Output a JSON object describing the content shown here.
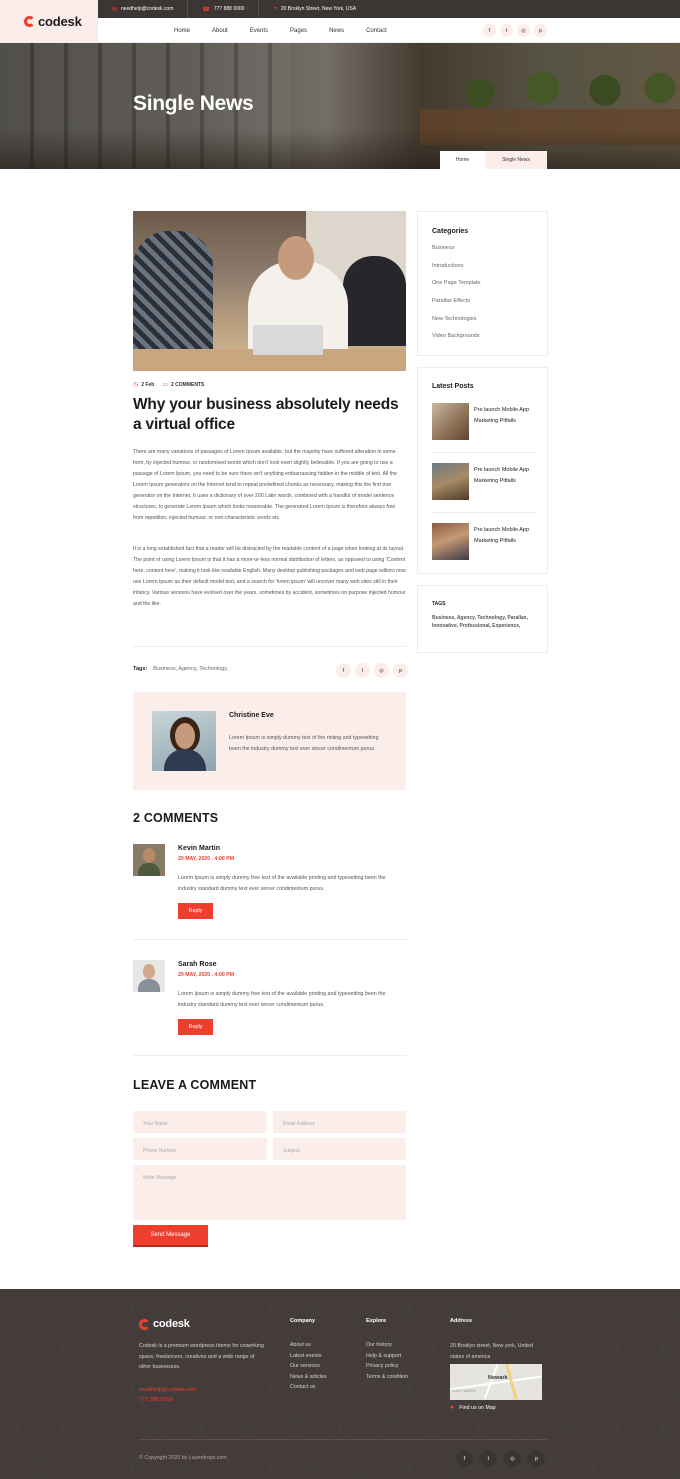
{
  "brand": {
    "name": "codesk"
  },
  "topbar": {
    "email": "needhelp@codesk.com",
    "phone": "777 888 0000",
    "address": "20 Broklyn Street, New York, USA"
  },
  "nav": {
    "items": [
      {
        "label": "Home"
      },
      {
        "label": "About"
      },
      {
        "label": "Events"
      },
      {
        "label": "Pages"
      },
      {
        "label": "News"
      },
      {
        "label": "Contact"
      }
    ],
    "social_icons": [
      "facebook-icon",
      "twitter-icon",
      "instagram-icon",
      "pinterest-icon"
    ]
  },
  "hero": {
    "title": "Single News",
    "breadcrumb": {
      "home": "Home",
      "current": "Single News"
    }
  },
  "post": {
    "date": "2 Feb",
    "comments_count": "2 COMMENTS",
    "title": "Why your business absolutely needs a virtual office",
    "paragraph_1": "There are many variations of passages of Lorem Ipsum available, but the majority have suffered alteration in some form, by injected humour, or randomised words which don't look even slightly believable. If you are going to use a passage of Lorem Ipsum, you need to be sure there isn't anything embarrassing hidden in the middle of text. All the Lorem Ipsum generators on the Internet tend to repeat predefined chunks as necessary, making this the first true generator on the Internet. It uses a dictionary of over 200 Latin words, combined with a handful of model sentence structures, to generate Lorem Ipsum which looks reasonable. The generated Lorem Ipsum is therefore always free from repetition, injected humour, or non-characteristic words etc.",
    "paragraph_2": "It is a long established fact that a reader will be distracted by the readable content of a page when looking at its layout. The point of using Lorem Ipsum is that it has a more-or-less normal distribution of letters, as opposed to using 'Content here, content here', making it look like readable English. Many desktop publishing packages and web page editors now use Lorem Ipsum as their default model text, and a search for 'lorem ipsum' will uncover many web sites still in their infancy. Various versions have evolved over the years, sometimes by accident, sometimes on purpose injected humour and the like.",
    "tags_label": "Tags:",
    "tags": "Business, Agency, Technology,"
  },
  "author": {
    "name": "Christine Eve",
    "bio": "Lorem Ipsum is simply dummy text of the rinting and typesetting been the industry dummy text ever sincer condimentum purus."
  },
  "comments": {
    "title": "2 COMMENTS",
    "items": [
      {
        "name": "Kevin Martin",
        "date": "20 MAY, 2020 . 4:00 PM",
        "text": "Lorem Ipsum is simply dummy free text of the available printing and typesetting been the industry standard dummy text ever sincer condimentum purus.",
        "reply": "Reply"
      },
      {
        "name": "Sarah Rose",
        "date": "20 MAY, 2020 . 4:00 PM",
        "text": "Lorem Ipsum is simply dummy free text of the available printing and typesetting been the industry standard dummy text ever sincer condimentum purus.",
        "reply": "Reply"
      }
    ]
  },
  "comment_form": {
    "title": "LEAVE A COMMENT",
    "name_placeholder": "Your Name",
    "email_placeholder": "Email Address",
    "phone_placeholder": "Phone Number",
    "subject_placeholder": "Subject",
    "message_placeholder": "Write Message",
    "submit": "Send Message"
  },
  "sidebar": {
    "categories_title": "Categories",
    "categories": [
      {
        "label": "Business"
      },
      {
        "label": "Introductions"
      },
      {
        "label": "One Page Template"
      },
      {
        "label": "Parallax Effects"
      },
      {
        "label": "New Technologies"
      },
      {
        "label": "Video Backgrounds"
      }
    ],
    "latest_title": "Latest Posts",
    "latest_posts": [
      {
        "title": "Pre launch Mobile App Marketing Pitfalls"
      },
      {
        "title": "Pre launch Mobile App Marketing Pitfalls"
      },
      {
        "title": "Pre launch Mobile App Marketing Pitfalls"
      }
    ],
    "tags_title": "TAGS",
    "tags": "Business, Agency, Technology, Parallax, Innovative, Professional, Experience,"
  },
  "footer": {
    "brand": "codesk",
    "about": "Codesk is a premium wordpress theme for coworking space, freelancers, creatives and a wide range of other businesses.",
    "email": "needhelp@codesk.com",
    "phone": "777 888 0000",
    "company_title": "Company",
    "company_links": [
      {
        "label": "About us"
      },
      {
        "label": "Latest events"
      },
      {
        "label": "Our services"
      },
      {
        "label": "News & articles"
      },
      {
        "label": "Contact us"
      }
    ],
    "explore_title": "Explore",
    "explore_links": [
      {
        "label": "Our history"
      },
      {
        "label": "Help & support"
      },
      {
        "label": "Privacy policy"
      },
      {
        "label": "Terms & condition"
      }
    ],
    "address_title": "Address",
    "address": "20 Broklyn street, New york, United states of america",
    "map_label": "Newark",
    "map_sublabel": "EAST WARD",
    "map_link": "Find us on Map",
    "copyright": "© Copyright 2020 by Layerdrops.com",
    "social_icons": [
      "facebook-icon",
      "twitter-icon",
      "instagram-icon",
      "pinterest-icon"
    ]
  },
  "colors": {
    "accent": "#ef3e2e",
    "dark": "#433c3a",
    "blush": "#fbeeea"
  }
}
